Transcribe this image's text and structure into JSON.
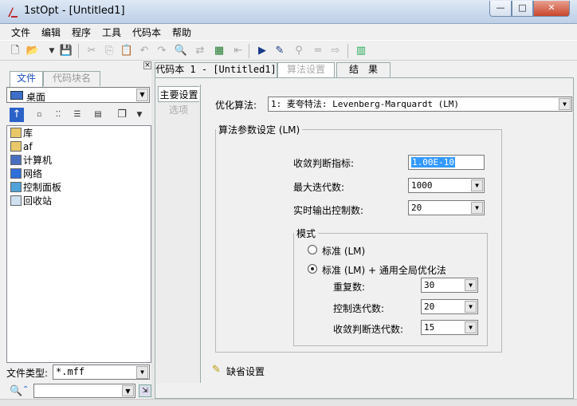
{
  "window": {
    "title": "1stOpt - [Untitled1]",
    "min_glyph": "—",
    "max_glyph": "□",
    "close_glyph": "✕"
  },
  "menu": [
    "文件",
    "编辑",
    "程序",
    "工具",
    "代码本",
    "帮助"
  ],
  "left_panel": {
    "close_glyph": "×",
    "tabs": [
      "文件",
      "代码块名"
    ],
    "drive_value": "桌面",
    "tree_items": [
      {
        "label": "库",
        "icon": "library-icon"
      },
      {
        "label": "af",
        "icon": "user-folder-icon"
      },
      {
        "label": "计算机",
        "icon": "computer-icon"
      },
      {
        "label": "网络",
        "icon": "network-icon"
      },
      {
        "label": "控制面板",
        "icon": "control-panel-icon"
      },
      {
        "label": "回收站",
        "icon": "recycle-bin-icon"
      }
    ],
    "filetype_label": "文件类型:",
    "filetype_value": "*.mff"
  },
  "right_tabs": [
    "代码本 1 - [Untitled1]",
    "算法设置",
    "结　果"
  ],
  "side_tabs": [
    "主要设置",
    "选项"
  ],
  "settings": {
    "algorithm_label": "优化算法:",
    "algorithm_value": "1: 麦夸特法: Levenberg-Marquardt (LM)",
    "group_title": "算法参数设定 (LM)",
    "convergence_label": "收敛判断指标:",
    "convergence_value": "1.00E-10",
    "max_iter_label": "最大迭代数:",
    "max_iter_value": "1000",
    "realtime_label": "实时输出控制数:",
    "realtime_value": "20",
    "mode_title": "模式",
    "mode_options": [
      "标准 (LM)",
      "标准 (LM) + 通用全局优化法"
    ],
    "selected_mode_index": 1,
    "repeat_label": "重复数:",
    "repeat_value": "30",
    "control_iter_label": "控制迭代数:",
    "control_iter_value": "20",
    "conv_iter_label": "收敛判断迭代数:",
    "conv_iter_value": "15",
    "default_label": "缺省设置"
  },
  "colors": {
    "accent_blue": "#1a4fbf",
    "selection": "#3399ff",
    "close_red": "#c9452c"
  }
}
